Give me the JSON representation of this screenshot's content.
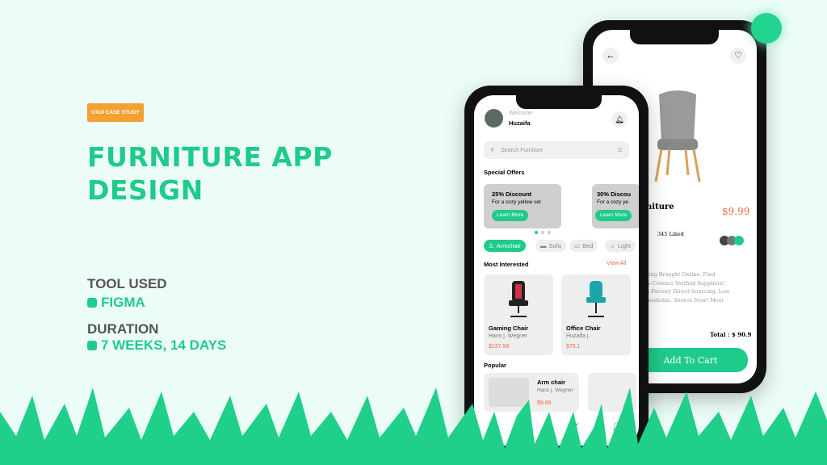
{
  "slide": {
    "badge": "UXUI CASE STUDY",
    "title_line1": "FURNITURE APP",
    "title_line2": "DESIGN",
    "tool_label": "TOOL USED",
    "tool_value": "FIGMA",
    "duration_label": "DURATION",
    "duration_value": "7 WEEKS, 14 DAYS"
  },
  "colors": {
    "accent": "#1fcb8a",
    "badge": "#f5a033",
    "price": "#f06a4a",
    "background": "#ecfdf7"
  },
  "home": {
    "welcome": "Welcome",
    "user": "Huzaifa",
    "search_placeholder": "Search Furniture",
    "special_offers": "Special Offers",
    "offers": [
      {
        "title": "25% Discount",
        "subtitle": "For a cozy yellow set",
        "button": "Learn More"
      },
      {
        "title": "30% Discou",
        "subtitle": "For a cozy ye",
        "button": "Learn More"
      }
    ],
    "categories": [
      "Armchair",
      "Sofa",
      "Bed",
      "Light"
    ],
    "most_interested": "Most Interested",
    "view_all": "View All",
    "products": [
      {
        "name": "Gaming Chair",
        "maker": "Hans j. Wegner",
        "price": "$137.99"
      },
      {
        "name": "Office Chair",
        "maker": "Huzaifa j.",
        "price": "$75.1"
      }
    ],
    "popular": "Popular",
    "popular_items": [
      {
        "name": "Arm chair",
        "maker": "Hans j. Wegner",
        "price": "$9.99"
      }
    ]
  },
  "detail": {
    "name": "niture",
    "price": "$9.99",
    "likes": "345 Liked",
    "description": [
      "ring Brought Online. Find",
      "& Contact Verified Suppliers!",
      "h Factory Direct Sourcing. Low",
      "Available. Source Now! Most"
    ],
    "total": "Total : $ 90.9",
    "add_to_cart": "Add To Cart"
  }
}
